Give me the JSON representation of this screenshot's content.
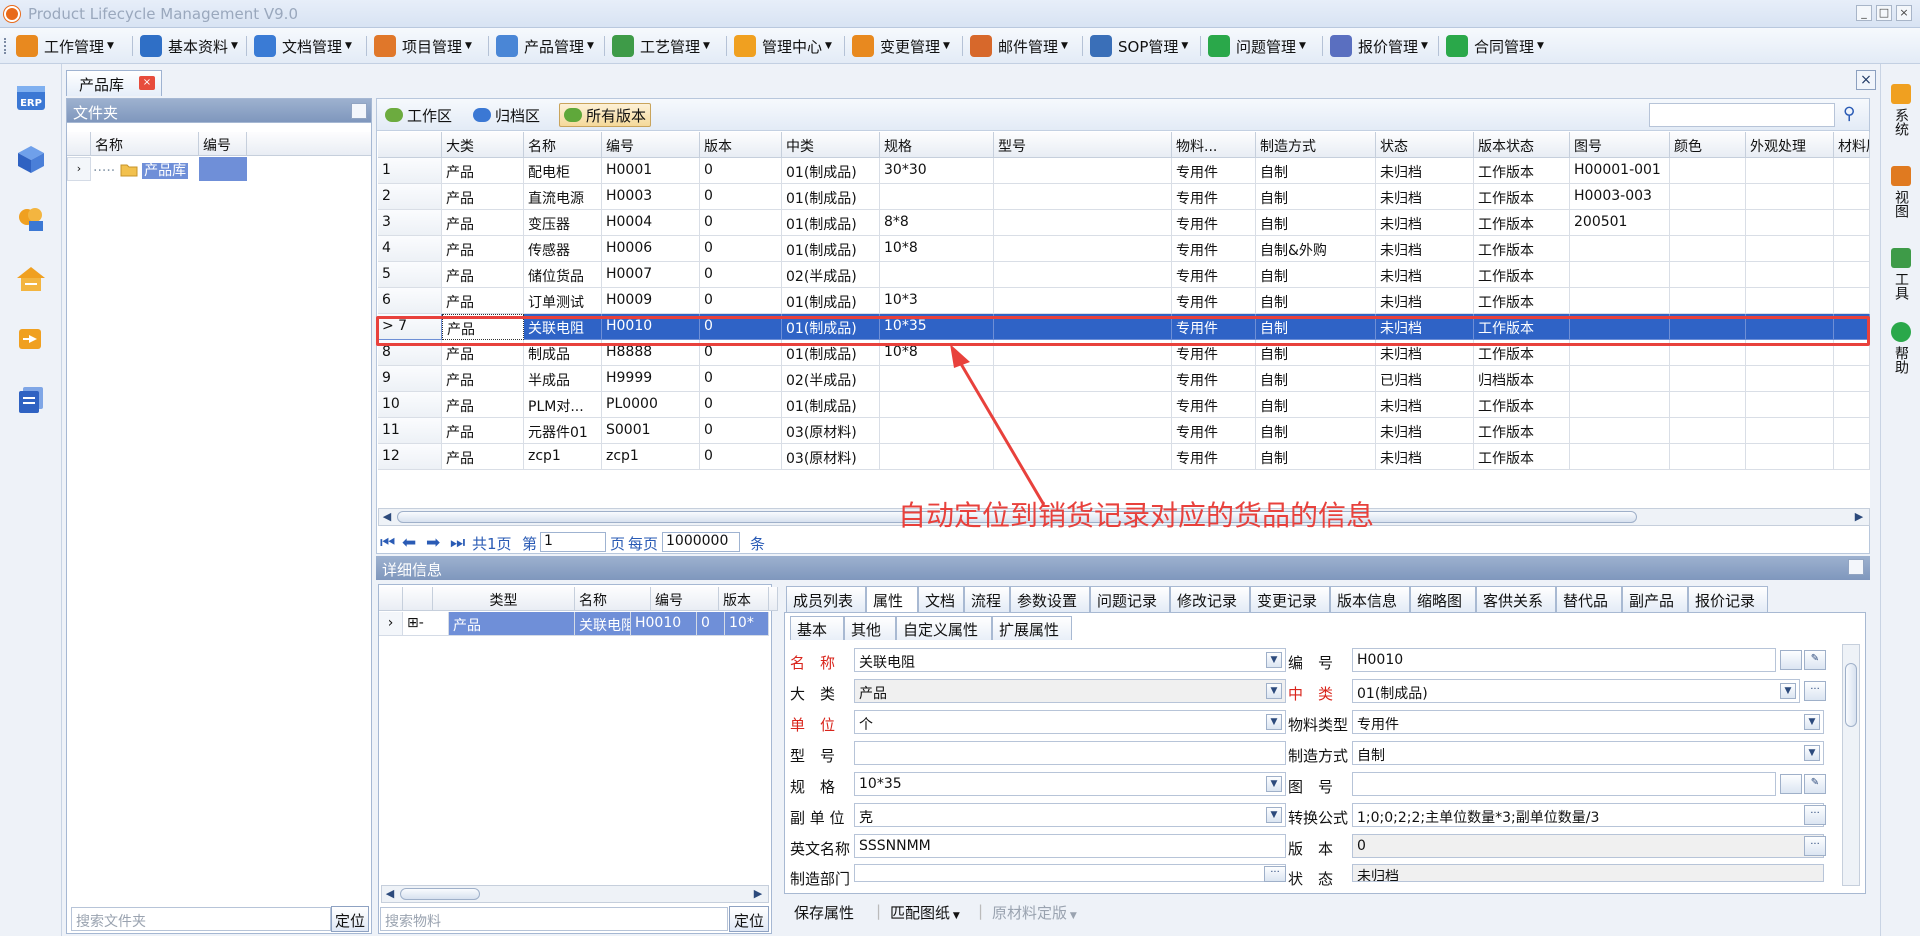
{
  "window": {
    "title": "Product Lifecycle Management V9.0"
  },
  "menu": [
    {
      "label": "工作管理",
      "color": "#e8891f"
    },
    {
      "label": "基本资料",
      "color": "#2f6fc6"
    },
    {
      "label": "文档管理",
      "color": "#3a7bd5"
    },
    {
      "label": "项目管理",
      "color": "#e0772a"
    },
    {
      "label": "产品管理",
      "color": "#4a86d6"
    },
    {
      "label": "工艺管理",
      "color": "#3e9b48"
    },
    {
      "label": "管理中心",
      "color": "#f0a020"
    },
    {
      "label": "变更管理",
      "color": "#e8891f"
    },
    {
      "label": "邮件管理",
      "color": "#d7682b"
    },
    {
      "label": "SOP管理",
      "color": "#3a6fb8"
    },
    {
      "label": "问题管理",
      "color": "#2aa84a"
    },
    {
      "label": "报价管理",
      "color": "#5a6fc0"
    },
    {
      "label": "合同管理",
      "color": "#2aa84a"
    }
  ],
  "leftstrip": {
    "erp_label": "ERP"
  },
  "rightstrip": [
    {
      "label": "系统",
      "color": "#f0a020"
    },
    {
      "label": "视图",
      "color": "#e07a20"
    },
    {
      "label": "工具",
      "color": "#3e9b48"
    },
    {
      "label": "帮助",
      "color": "#2aa84a"
    }
  ],
  "doctab": {
    "label": "产品库",
    "close": "×"
  },
  "folder": {
    "title": "文件夹",
    "col_name": "名称",
    "col_code": "编号",
    "root_label": "产品库",
    "search_placeholder": "搜索文件夹",
    "locate": "定位"
  },
  "toolbar": {
    "workspace": "工作区",
    "archive": "归档区",
    "all_versions": "所有版本"
  },
  "grid": {
    "columns": [
      "",
      "大类",
      "名称",
      "编号",
      "版本",
      "中类",
      "规格",
      "型号",
      "物料...",
      "制造方式",
      "状态",
      "版本状态",
      "图号",
      "颜色",
      "外观处理",
      "材料属"
    ],
    "rows": [
      [
        "1",
        "产品",
        "配电柜",
        "H0001",
        "0",
        "01(制成品)",
        "30*30",
        "",
        "专用件",
        "自制",
        "未归档",
        "工作版本",
        "H00001-001",
        "",
        "",
        ""
      ],
      [
        "2",
        "产品",
        "直流电源",
        "H0003",
        "0",
        "01(制成品)",
        "",
        "",
        "专用件",
        "自制",
        "未归档",
        "工作版本",
        "H0003-003",
        "",
        "",
        ""
      ],
      [
        "3",
        "产品",
        "变压器",
        "H0004",
        "0",
        "01(制成品)",
        "8*8",
        "",
        "专用件",
        "自制",
        "未归档",
        "工作版本",
        "200501",
        "",
        "",
        ""
      ],
      [
        "4",
        "产品",
        "传感器",
        "H0006",
        "0",
        "01(制成品)",
        "10*8",
        "",
        "专用件",
        "自制&外购",
        "未归档",
        "工作版本",
        "",
        "",
        "",
        ""
      ],
      [
        "5",
        "产品",
        "储位货品",
        "H0007",
        "0",
        "02(半成品)",
        "",
        "",
        "专用件",
        "自制",
        "未归档",
        "工作版本",
        "",
        "",
        "",
        ""
      ],
      [
        "6",
        "产品",
        "订单测试",
        "H0009",
        "0",
        "01(制成品)",
        "10*3",
        "",
        "专用件",
        "自制",
        "未归档",
        "工作版本",
        "",
        "",
        "",
        ""
      ],
      [
        "7",
        "产品",
        "关联电阻",
        "H0010",
        "0",
        "01(制成品)",
        "10*35",
        "",
        "专用件",
        "自制",
        "未归档",
        "工作版本",
        "",
        "",
        "",
        ""
      ],
      [
        "8",
        "产品",
        "制成品",
        "H8888",
        "0",
        "01(制成品)",
        "10*8",
        "",
        "专用件",
        "自制",
        "未归档",
        "工作版本",
        "",
        "",
        "",
        ""
      ],
      [
        "9",
        "产品",
        "半成品",
        "H9999",
        "0",
        "02(半成品)",
        "",
        "",
        "专用件",
        "自制",
        "已归档",
        "归档版本",
        "",
        "",
        "",
        ""
      ],
      [
        "10",
        "产品",
        "PLM对...",
        "PL0000",
        "0",
        "01(制成品)",
        "",
        "",
        "专用件",
        "自制",
        "未归档",
        "工作版本",
        "",
        "",
        "",
        ""
      ],
      [
        "11",
        "产品",
        "元器件01",
        "S0001",
        "0",
        "03(原材料)",
        "",
        "",
        "专用件",
        "自制",
        "未归档",
        "工作版本",
        "",
        "",
        "",
        ""
      ],
      [
        "12",
        "产品",
        "zcp1",
        "zcp1",
        "0",
        "03(原材料)",
        "",
        "",
        "专用件",
        "自制",
        "未归档",
        "工作版本",
        "",
        "",
        "",
        ""
      ]
    ],
    "selected_row": 6,
    "selected_marker": "> 7"
  },
  "pager": {
    "total": "共1页",
    "page_label": "第",
    "page": "1",
    "page_unit": "页",
    "per_page_label": "每页",
    "per_page": "1000000",
    "unit": "条"
  },
  "annotation": {
    "text": "自动定位到销货记录对应的货品的信息",
    "color": "#e8413c"
  },
  "detail": {
    "title": "详细信息",
    "sub_columns": [
      "类型",
      "名称",
      "编号",
      "版本",
      "规"
    ],
    "sub_row": [
      "产品",
      "关联电阻",
      "H0010",
      "0",
      "10*"
    ],
    "search_placeholder": "搜索物料",
    "locate": "定位"
  },
  "tabs": [
    "成员列表",
    "属性",
    "文档",
    "流程",
    "参数设置",
    "问题记录",
    "修改记录",
    "变更记录",
    "版本信息",
    "缩略图",
    "客供关系",
    "替代品",
    "副产品",
    "报价记录"
  ],
  "subtabs": [
    "基本",
    "其他",
    "自定义属性",
    "扩展属性"
  ],
  "form": {
    "name_label": "名　称",
    "name": "关联电阻",
    "code_label": "编　号",
    "code": "H0010",
    "major_label": "大　类",
    "major": "产品",
    "mid_label": "中　类",
    "mid": "01(制成品)",
    "unit_label": "单　位",
    "unit": "个",
    "mtype_label": "物料类型",
    "mtype": "专用件",
    "model_label": "型　号",
    "model": "",
    "mfg_label": "制造方式",
    "mfg": "自制",
    "spec_label": "规　格",
    "spec": "10*35",
    "drawing_label": "图　号",
    "drawing": "",
    "subunit_label": "副 单 位",
    "subunit": "克",
    "formula_label": "转换公式",
    "formula": "1;0;0;2;2;主单位数量*3;副单位数量/3",
    "en_label": "英文名称",
    "en": "SSSNNMM",
    "version_label": "版　本",
    "version": "0",
    "dept_label": "制造部门",
    "dept": "",
    "status_label": "状　态",
    "status": "未归档"
  },
  "bottombar": {
    "save": "保存属性",
    "match": "匹配图纸",
    "material": "原材料定版"
  }
}
